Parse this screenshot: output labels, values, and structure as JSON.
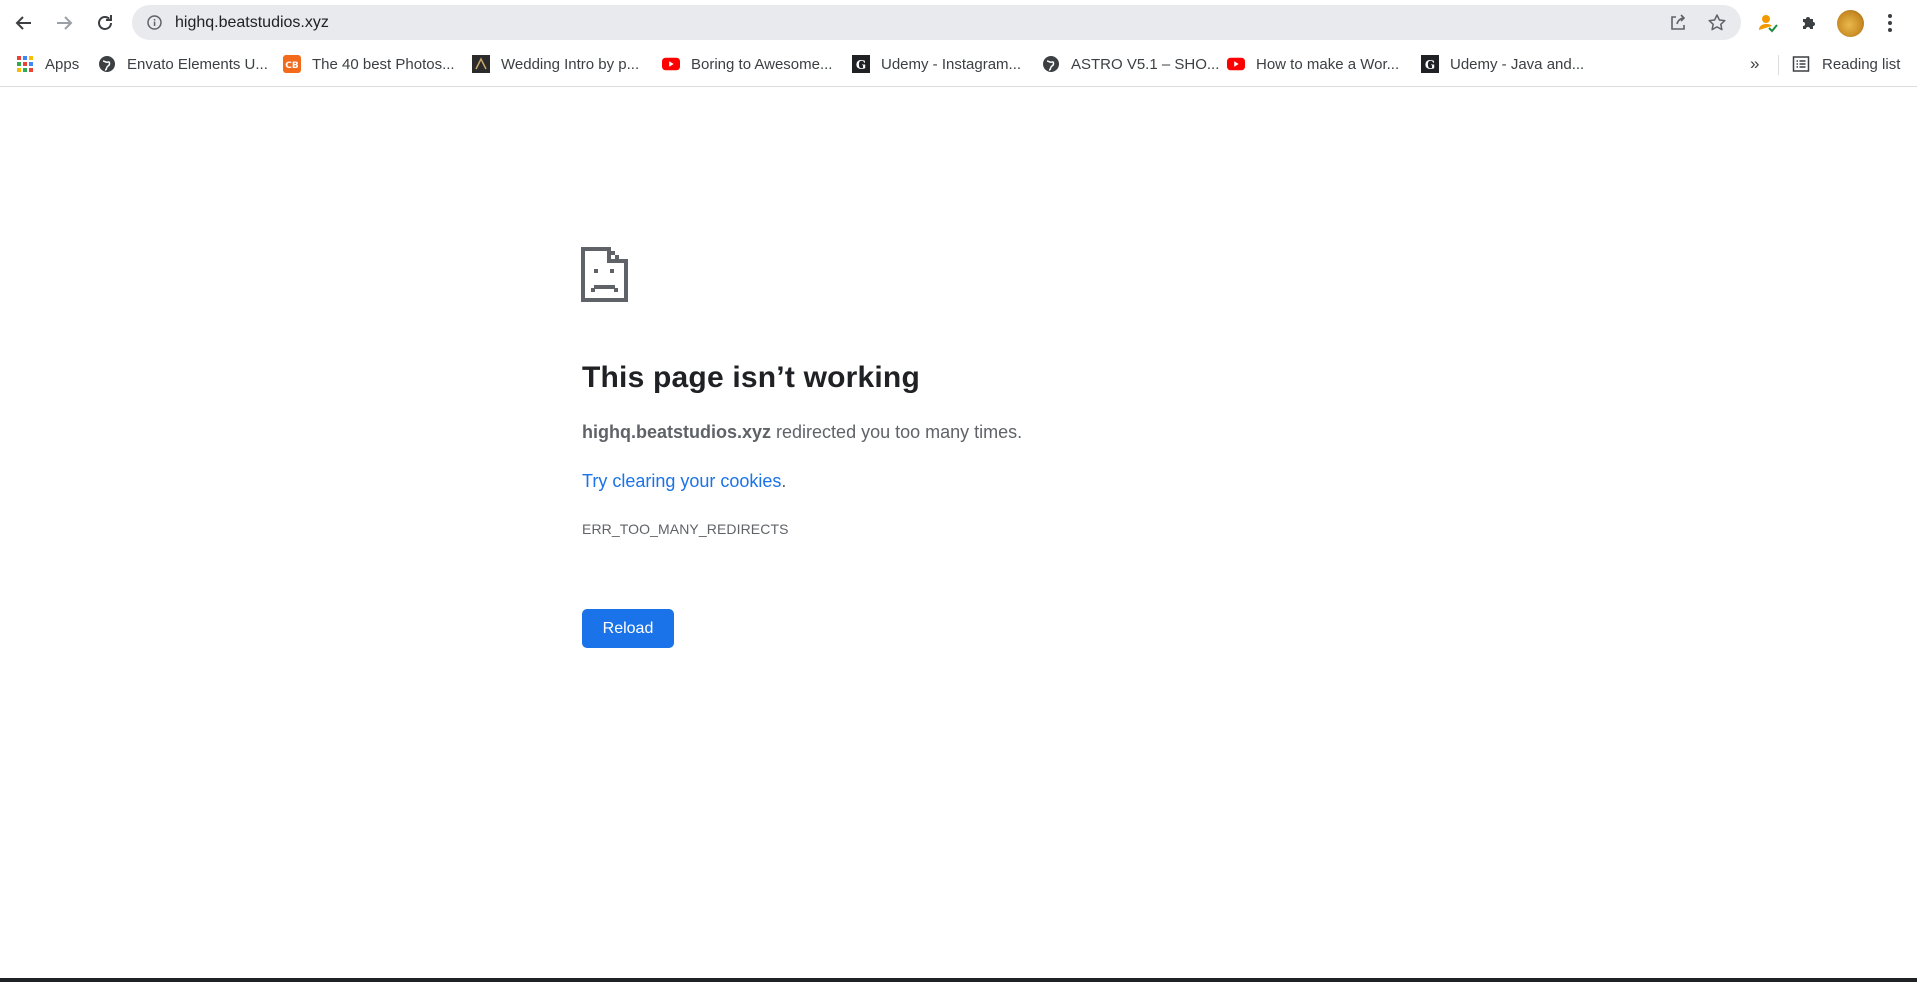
{
  "browser": {
    "url": "highq.beatstudios.xyz",
    "icons": {
      "back": "arrow-left-icon",
      "forward": "arrow-right-icon",
      "reload": "refresh-icon",
      "site_info": "info-icon",
      "share": "share-icon",
      "bookmark": "star-icon",
      "extensions": "puzzle-icon",
      "menu": "vertical-dots-icon"
    }
  },
  "bookmarks": {
    "items": [
      {
        "label": "Apps",
        "icon": "apps-grid-icon"
      },
      {
        "label": "Envato Elements U...",
        "icon": "globe-icon"
      },
      {
        "label": "The 40 best Photos...",
        "icon": "cb-icon"
      },
      {
        "label": "Wedding Intro by p...",
        "icon": "wedding-thumbnail-icon"
      },
      {
        "label": "Boring to Awesome...",
        "icon": "youtube-icon"
      },
      {
        "label": "Udemy - Instagram...",
        "icon": "g-square-icon"
      },
      {
        "label": "ASTRO V5.1 – SHO...",
        "icon": "globe-icon"
      },
      {
        "label": "How to make a Wor...",
        "icon": "youtube-icon"
      },
      {
        "label": "Udemy - Java and...",
        "icon": "g-square-icon"
      }
    ],
    "more": "»",
    "reading_list": "Reading list"
  },
  "error": {
    "title": "This page isn’t working",
    "host": "highq.beatstudios.xyz",
    "description_rest": " redirected you too many times.",
    "suggestion_link": "Try clearing your cookies",
    "suggestion_end": ".",
    "code": "ERR_TOO_MANY_REDIRECTS",
    "reload_label": "Reload"
  },
  "colors": {
    "accent": "#1a73e8",
    "text": "#202124",
    "secondary_text": "#5f6368",
    "omnibox_bg": "#e8eaed"
  }
}
